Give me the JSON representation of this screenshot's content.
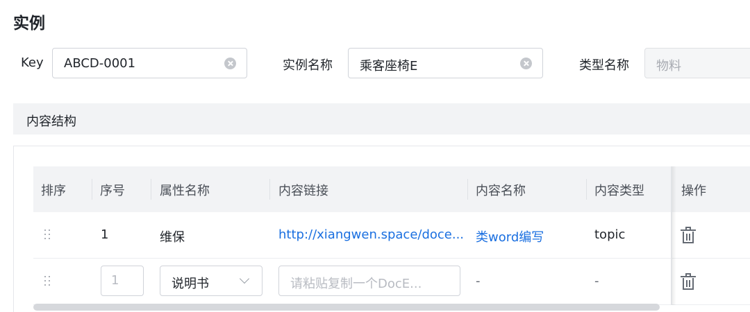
{
  "page": {
    "title": "实例"
  },
  "form": {
    "key": {
      "label": "Key",
      "value": "ABCD-0001"
    },
    "instance_name": {
      "label": "实例名称",
      "value": "乘客座椅E"
    },
    "type_name": {
      "label": "类型名称",
      "value": "物料"
    }
  },
  "section": {
    "title": "内容结构"
  },
  "table": {
    "columns": [
      "排序",
      "序号",
      "属性名称",
      "内容链接",
      "内容名称",
      "内容类型",
      "操作"
    ],
    "rows": [
      {
        "index": "1",
        "attribute": "维保",
        "link": "http://xiangwen.space/doce...",
        "content_name": "类word编写",
        "content_type": "topic"
      }
    ],
    "new_row": {
      "index_placeholder": "1",
      "attribute_select": "说明书",
      "link_placeholder": "请粘贴复制一个DocE...",
      "content_name": "-",
      "content_type": "-"
    }
  },
  "colors": {
    "link": "#1a6fe0",
    "header_bg": "#f2f3f5"
  }
}
